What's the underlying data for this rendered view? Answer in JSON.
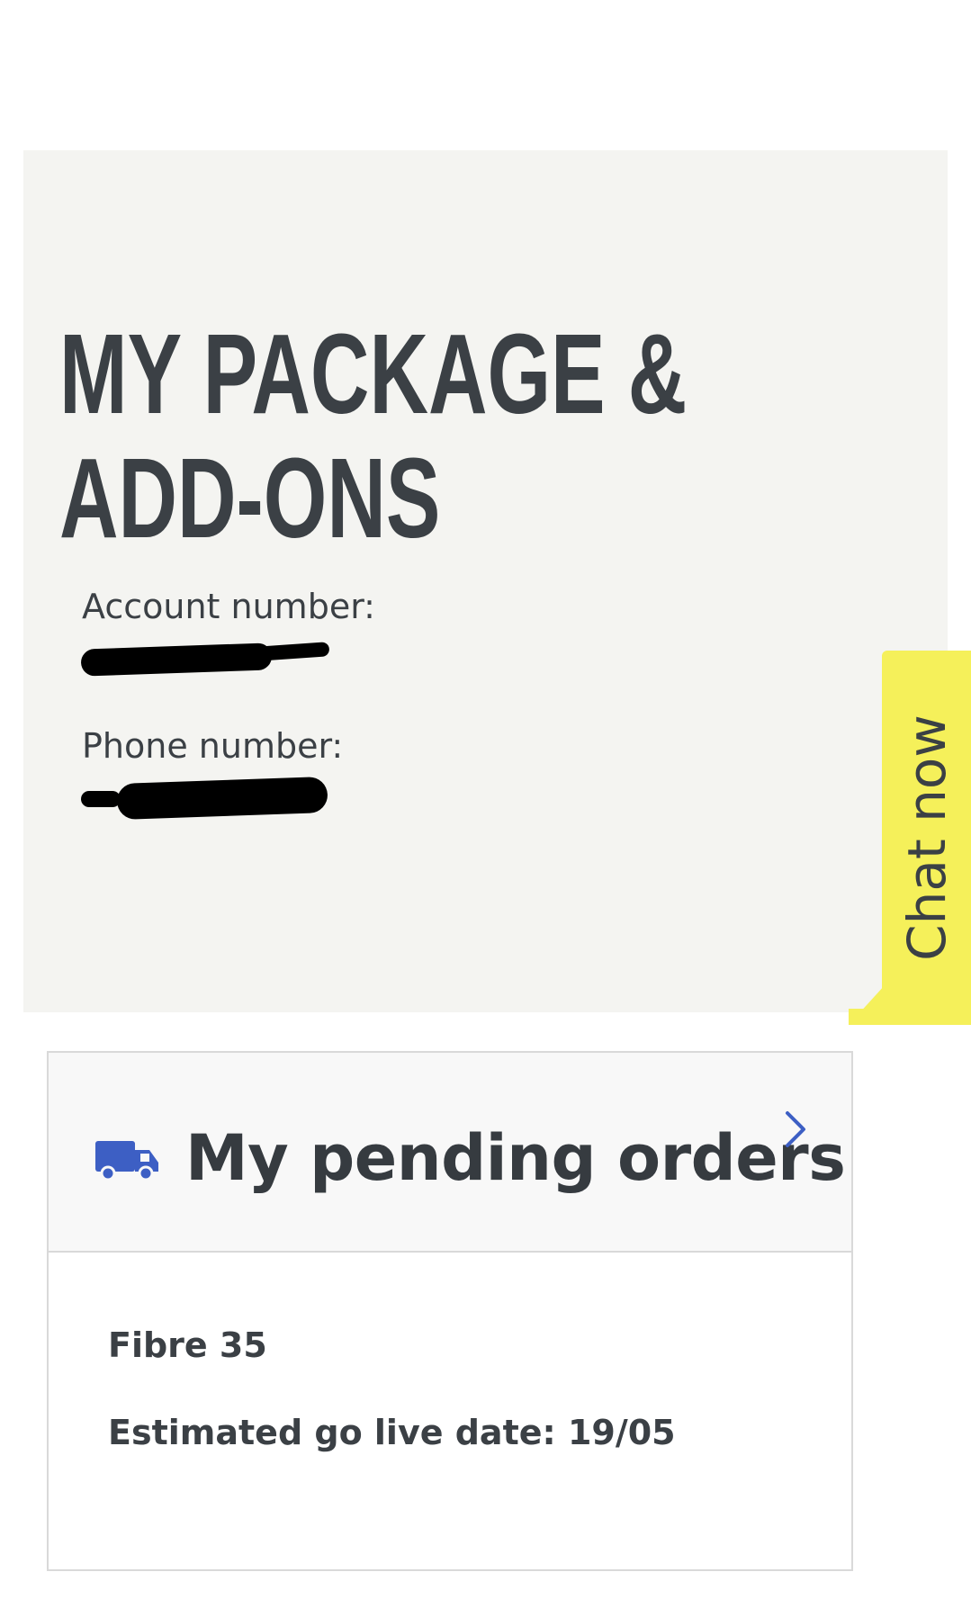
{
  "header": {
    "title_line1": "MY PACKAGE &",
    "title_line2": "ADD-ONS",
    "account_label": "Account number:",
    "phone_label": "Phone number:"
  },
  "chat": {
    "label": "Chat now",
    "color": "#f5f05a"
  },
  "pending_orders": {
    "title": "My pending orders",
    "icon": "truck-icon",
    "accent_color": "#3d5fc4",
    "orders": [
      {
        "name": "Fibre 35",
        "go_live": "Estimated go live date: 19/05"
      }
    ]
  }
}
